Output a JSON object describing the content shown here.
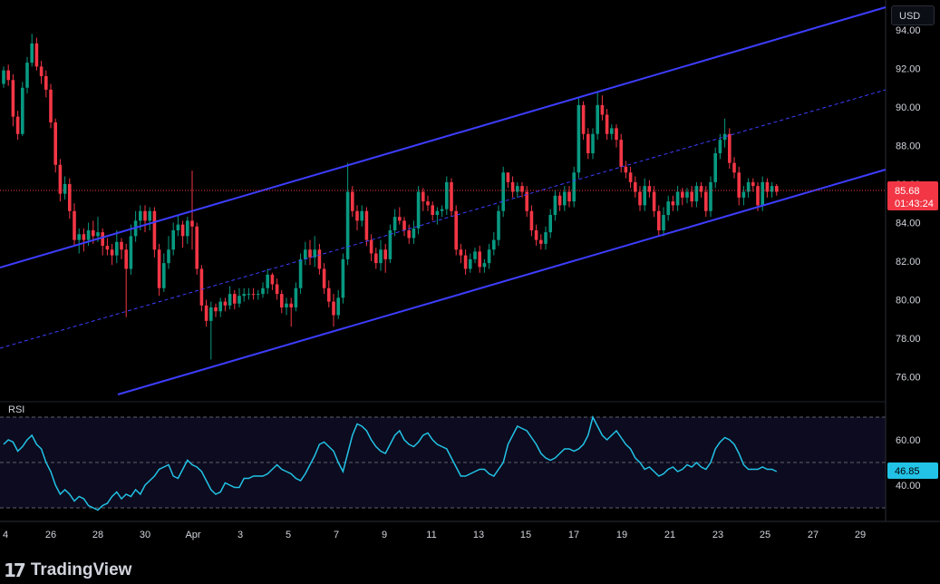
{
  "currency_label": "USD",
  "watermark": {
    "brand": "TradingView",
    "mark": "17"
  },
  "colors": {
    "up": "#089981",
    "down": "#f23645",
    "channel": "#3d3dff",
    "rsi": "#22c3e6",
    "price_line": "#f23645"
  },
  "price_badge": {
    "price": "85.68",
    "countdown": "01:43:24"
  },
  "rsi_badge": "46.85",
  "rsi_label": "RSI",
  "chart_data": {
    "type": "candlestick",
    "price_axis": {
      "ticks": [
        "94.00",
        "92.00",
        "90.00",
        "88.00",
        "86.00",
        "84.00",
        "82.00",
        "80.00",
        "78.00",
        "76.00"
      ],
      "range": [
        74.9,
        95.4
      ]
    },
    "rsi_axis": {
      "ticks": [
        "60.00",
        "40.00"
      ],
      "range": [
        25,
        80
      ],
      "bands": [
        70,
        50,
        30
      ]
    },
    "x_ticks": [
      "4",
      "26",
      "28",
      "30",
      "Apr",
      "3",
      "5",
      "7",
      "9",
      "11",
      "13",
      "15",
      "17",
      "19",
      "21",
      "23",
      "25",
      "27",
      "29"
    ],
    "candles": [
      [
        91.2,
        91.9,
        91.0,
        92.1,
        "up"
      ],
      [
        91.9,
        91.4,
        91.1,
        92.2,
        "dn"
      ],
      [
        91.4,
        89.5,
        89.0,
        91.7,
        "dn"
      ],
      [
        89.5,
        88.6,
        88.3,
        89.8,
        "dn"
      ],
      [
        88.6,
        91.0,
        88.5,
        91.3,
        "up"
      ],
      [
        91.0,
        92.3,
        90.7,
        92.6,
        "up"
      ],
      [
        92.3,
        93.3,
        92.1,
        93.8,
        "up"
      ],
      [
        93.3,
        92.1,
        91.9,
        93.6,
        "dn"
      ],
      [
        92.1,
        91.6,
        91.2,
        92.4,
        "dn"
      ],
      [
        91.6,
        90.9,
        90.5,
        91.9,
        "dn"
      ],
      [
        90.9,
        89.2,
        88.9,
        91.2,
        "dn"
      ],
      [
        89.2,
        87.0,
        86.6,
        89.4,
        "dn"
      ],
      [
        87.0,
        85.5,
        85.1,
        87.3,
        "dn"
      ],
      [
        85.5,
        86.0,
        85.2,
        86.4,
        "up"
      ],
      [
        86.0,
        84.6,
        84.2,
        86.3,
        "dn"
      ],
      [
        84.6,
        83.1,
        82.8,
        85.0,
        "dn"
      ],
      [
        83.1,
        83.4,
        82.4,
        83.7,
        "up"
      ],
      [
        83.4,
        83.1,
        82.5,
        83.7,
        "dn"
      ],
      [
        83.1,
        83.6,
        82.8,
        84.0,
        "up"
      ],
      [
        83.6,
        83.3,
        82.9,
        84.1,
        "dn"
      ],
      [
        83.3,
        83.5,
        83.0,
        84.3,
        "up"
      ],
      [
        83.5,
        82.8,
        82.3,
        83.7,
        "dn"
      ],
      [
        82.8,
        82.6,
        82.3,
        83.2,
        "dn"
      ],
      [
        82.6,
        82.3,
        81.8,
        82.9,
        "dn"
      ],
      [
        82.3,
        83.0,
        81.9,
        83.6,
        "up"
      ],
      [
        83.0,
        82.6,
        82.1,
        83.2,
        "dn"
      ],
      [
        82.6,
        81.6,
        79.1,
        82.9,
        "dn"
      ],
      [
        81.6,
        83.3,
        81.3,
        83.9,
        "up"
      ],
      [
        83.3,
        84.1,
        83.0,
        84.6,
        "up"
      ],
      [
        84.1,
        84.6,
        83.6,
        84.9,
        "up"
      ],
      [
        84.6,
        84.1,
        83.5,
        84.9,
        "dn"
      ],
      [
        84.1,
        84.6,
        83.6,
        84.8,
        "up"
      ],
      [
        84.6,
        82.6,
        82.2,
        84.8,
        "dn"
      ],
      [
        82.6,
        80.6,
        80.2,
        82.9,
        "dn"
      ],
      [
        80.6,
        81.9,
        80.4,
        82.4,
        "up"
      ],
      [
        81.9,
        82.6,
        81.6,
        83.3,
        "up"
      ],
      [
        82.6,
        83.6,
        82.3,
        84.0,
        "up"
      ],
      [
        83.6,
        83.9,
        83.3,
        84.4,
        "up"
      ],
      [
        83.9,
        83.3,
        82.7,
        84.1,
        "dn"
      ],
      [
        83.3,
        84.1,
        82.9,
        84.3,
        "up"
      ],
      [
        84.1,
        83.8,
        82.6,
        86.7,
        "dn"
      ],
      [
        83.8,
        81.6,
        81.3,
        84.0,
        "dn"
      ],
      [
        81.6,
        79.7,
        79.4,
        81.8,
        "dn"
      ],
      [
        79.7,
        78.9,
        78.6,
        80.0,
        "dn"
      ],
      [
        78.9,
        79.6,
        76.9,
        79.9,
        "up"
      ],
      [
        79.6,
        79.4,
        79.1,
        79.8,
        "dn"
      ],
      [
        79.4,
        79.9,
        79.1,
        80.1,
        "up"
      ],
      [
        79.9,
        79.7,
        79.4,
        80.1,
        "dn"
      ],
      [
        79.7,
        80.3,
        79.5,
        80.7,
        "up"
      ],
      [
        80.3,
        79.8,
        79.5,
        80.5,
        "dn"
      ],
      [
        79.8,
        80.2,
        79.6,
        80.6,
        "up"
      ],
      [
        80.2,
        80.3,
        79.9,
        80.6,
        "up"
      ],
      [
        80.3,
        80.3,
        80.0,
        80.6,
        "up"
      ],
      [
        80.3,
        80.3,
        80.0,
        80.6,
        "dn"
      ],
      [
        80.3,
        80.3,
        80.0,
        80.5,
        "up"
      ],
      [
        80.3,
        80.6,
        80.1,
        80.9,
        "up"
      ],
      [
        80.6,
        81.3,
        80.3,
        81.6,
        "up"
      ],
      [
        81.3,
        80.8,
        80.5,
        81.4,
        "dn"
      ],
      [
        80.8,
        80.3,
        80.0,
        81.1,
        "dn"
      ],
      [
        80.3,
        79.6,
        79.3,
        80.5,
        "dn"
      ],
      [
        79.6,
        79.8,
        79.2,
        80.1,
        "up"
      ],
      [
        79.8,
        79.6,
        78.6,
        80.1,
        "dn"
      ],
      [
        79.6,
        80.6,
        79.4,
        80.9,
        "up"
      ],
      [
        80.6,
        82.1,
        80.3,
        82.4,
        "up"
      ],
      [
        82.1,
        82.6,
        81.8,
        83.0,
        "up"
      ],
      [
        82.6,
        82.2,
        81.8,
        83.1,
        "dn"
      ],
      [
        82.2,
        82.6,
        81.7,
        83.3,
        "up"
      ],
      [
        82.6,
        81.6,
        81.3,
        82.9,
        "dn"
      ],
      [
        81.6,
        80.6,
        80.3,
        81.9,
        "dn"
      ],
      [
        80.6,
        79.9,
        79.6,
        81.0,
        "dn"
      ],
      [
        79.9,
        79.2,
        78.6,
        80.3,
        "dn"
      ],
      [
        79.2,
        80.1,
        79.0,
        80.5,
        "up"
      ],
      [
        80.1,
        82.1,
        79.8,
        82.4,
        "up"
      ],
      [
        82.1,
        85.6,
        81.8,
        87.1,
        "up"
      ],
      [
        85.6,
        84.6,
        84.3,
        85.9,
        "dn"
      ],
      [
        84.6,
        84.1,
        83.6,
        84.9,
        "dn"
      ],
      [
        84.1,
        84.6,
        83.8,
        84.9,
        "up"
      ],
      [
        84.6,
        83.1,
        82.8,
        84.8,
        "dn"
      ],
      [
        83.1,
        82.4,
        82.0,
        83.4,
        "dn"
      ],
      [
        82.4,
        81.9,
        81.6,
        82.7,
        "dn"
      ],
      [
        81.9,
        82.6,
        81.5,
        83.1,
        "up"
      ],
      [
        82.6,
        82.1,
        81.4,
        82.9,
        "dn"
      ],
      [
        82.1,
        83.6,
        81.9,
        83.9,
        "up"
      ],
      [
        83.6,
        84.3,
        83.3,
        84.7,
        "up"
      ],
      [
        84.3,
        84.1,
        83.9,
        84.8,
        "dn"
      ],
      [
        84.1,
        83.6,
        83.3,
        84.3,
        "dn"
      ],
      [
        83.6,
        83.2,
        82.9,
        83.9,
        "dn"
      ],
      [
        83.2,
        83.7,
        82.9,
        84.1,
        "up"
      ],
      [
        83.7,
        85.6,
        83.4,
        85.9,
        "up"
      ],
      [
        85.6,
        85.1,
        84.6,
        85.8,
        "dn"
      ],
      [
        85.1,
        84.9,
        84.6,
        85.4,
        "dn"
      ],
      [
        84.9,
        84.4,
        84.1,
        85.1,
        "dn"
      ],
      [
        84.4,
        84.6,
        83.9,
        84.8,
        "up"
      ],
      [
        84.6,
        84.7,
        84.3,
        84.9,
        "up"
      ],
      [
        84.7,
        86.1,
        84.4,
        86.4,
        "up"
      ],
      [
        86.1,
        84.6,
        84.3,
        86.3,
        "dn"
      ],
      [
        84.6,
        82.6,
        82.3,
        84.9,
        "dn"
      ],
      [
        82.6,
        82.3,
        81.9,
        82.9,
        "dn"
      ],
      [
        82.3,
        81.6,
        81.3,
        82.6,
        "dn"
      ],
      [
        81.6,
        82.1,
        81.4,
        82.4,
        "up"
      ],
      [
        82.1,
        82.5,
        81.9,
        82.7,
        "up"
      ],
      [
        82.5,
        81.7,
        81.4,
        82.8,
        "dn"
      ],
      [
        81.7,
        81.9,
        81.4,
        82.1,
        "up"
      ],
      [
        81.9,
        82.6,
        81.6,
        82.9,
        "up"
      ],
      [
        82.6,
        83.1,
        82.3,
        83.5,
        "up"
      ],
      [
        83.1,
        84.6,
        82.8,
        84.9,
        "up"
      ],
      [
        84.6,
        86.6,
        84.3,
        86.9,
        "up"
      ],
      [
        86.6,
        86.1,
        85.8,
        86.6,
        "dn"
      ],
      [
        86.1,
        85.6,
        85.3,
        86.4,
        "dn"
      ],
      [
        85.6,
        85.9,
        85.3,
        86.1,
        "up"
      ],
      [
        85.9,
        85.6,
        85.3,
        86.1,
        "dn"
      ],
      [
        85.6,
        84.6,
        84.3,
        85.9,
        "dn"
      ],
      [
        84.6,
        83.6,
        83.3,
        84.9,
        "dn"
      ],
      [
        83.6,
        83.1,
        82.8,
        83.9,
        "dn"
      ],
      [
        83.1,
        82.9,
        82.6,
        83.4,
        "dn"
      ],
      [
        82.9,
        83.5,
        82.6,
        83.8,
        "up"
      ],
      [
        83.5,
        84.4,
        83.2,
        84.7,
        "up"
      ],
      [
        84.4,
        85.4,
        84.1,
        85.7,
        "up"
      ],
      [
        85.4,
        84.9,
        84.6,
        85.6,
        "dn"
      ],
      [
        84.9,
        85.6,
        84.6,
        85.9,
        "up"
      ],
      [
        85.6,
        85.1,
        84.8,
        85.9,
        "dn"
      ],
      [
        85.1,
        86.6,
        84.8,
        86.9,
        "up"
      ],
      [
        86.6,
        90.1,
        86.3,
        90.5,
        "up"
      ],
      [
        90.1,
        88.6,
        88.3,
        90.3,
        "dn"
      ],
      [
        88.6,
        87.6,
        87.3,
        88.9,
        "dn"
      ],
      [
        87.6,
        88.6,
        87.3,
        88.9,
        "up"
      ],
      [
        88.6,
        90.1,
        88.3,
        90.8,
        "up"
      ],
      [
        90.1,
        89.6,
        89.3,
        90.6,
        "dn"
      ],
      [
        89.6,
        88.6,
        88.3,
        89.9,
        "dn"
      ],
      [
        88.6,
        88.9,
        88.3,
        89.1,
        "up"
      ],
      [
        88.9,
        88.3,
        87.9,
        89.1,
        "dn"
      ],
      [
        88.3,
        86.9,
        86.6,
        88.6,
        "dn"
      ],
      [
        86.9,
        86.6,
        86.3,
        87.2,
        "dn"
      ],
      [
        86.6,
        86.1,
        85.8,
        86.9,
        "dn"
      ],
      [
        86.1,
        85.6,
        85.3,
        86.4,
        "dn"
      ],
      [
        85.6,
        84.9,
        84.6,
        85.9,
        "dn"
      ],
      [
        84.9,
        85.9,
        84.6,
        86.3,
        "up"
      ],
      [
        85.9,
        85.6,
        85.3,
        86.2,
        "dn"
      ],
      [
        85.6,
        84.6,
        84.3,
        85.9,
        "dn"
      ],
      [
        84.6,
        83.6,
        83.3,
        84.9,
        "dn"
      ],
      [
        83.6,
        84.4,
        83.3,
        84.8,
        "up"
      ],
      [
        84.4,
        85.1,
        84.1,
        85.4,
        "up"
      ],
      [
        85.1,
        84.9,
        84.6,
        85.4,
        "dn"
      ],
      [
        84.9,
        85.6,
        84.6,
        85.9,
        "up"
      ],
      [
        85.6,
        85.3,
        84.9,
        85.8,
        "dn"
      ],
      [
        85.3,
        85.6,
        85.0,
        85.8,
        "up"
      ],
      [
        85.6,
        85.1,
        84.8,
        85.9,
        "dn"
      ],
      [
        85.1,
        85.9,
        84.8,
        86.1,
        "up"
      ],
      [
        85.9,
        85.6,
        85.3,
        86.1,
        "dn"
      ],
      [
        85.6,
        84.6,
        84.3,
        85.9,
        "dn"
      ],
      [
        84.6,
        86.1,
        84.3,
        86.4,
        "up"
      ],
      [
        86.1,
        87.6,
        85.8,
        87.9,
        "up"
      ],
      [
        87.6,
        88.3,
        87.3,
        88.6,
        "up"
      ],
      [
        88.3,
        88.6,
        87.9,
        89.4,
        "up"
      ],
      [
        88.6,
        87.1,
        86.8,
        88.9,
        "dn"
      ],
      [
        87.1,
        86.6,
        86.3,
        87.4,
        "dn"
      ],
      [
        86.6,
        85.3,
        84.9,
        86.9,
        "dn"
      ],
      [
        85.3,
        85.6,
        84.9,
        85.9,
        "up"
      ],
      [
        85.6,
        86.1,
        85.3,
        86.3,
        "up"
      ],
      [
        86.1,
        85.9,
        85.6,
        86.3,
        "dn"
      ],
      [
        85.9,
        84.9,
        84.6,
        86.1,
        "dn"
      ],
      [
        84.9,
        86.1,
        84.6,
        86.4,
        "up"
      ],
      [
        86.1,
        85.6,
        85.3,
        86.3,
        "dn"
      ],
      [
        85.6,
        85.9,
        85.3,
        86.1,
        "up"
      ],
      [
        85.9,
        85.6,
        85.4,
        86.0,
        "dn"
      ]
    ],
    "rsi": [
      58,
      60,
      59,
      55,
      57,
      60,
      62,
      58,
      56,
      50,
      46,
      40,
      36,
      38,
      36,
      33,
      35,
      34,
      31,
      30,
      29,
      31,
      32,
      35,
      37,
      34,
      36,
      35,
      38,
      36,
      40,
      42,
      44,
      47,
      48,
      49,
      44,
      43,
      47,
      51,
      49,
      48,
      46,
      42,
      38,
      36,
      37,
      41,
      40,
      39,
      39,
      43,
      43,
      44,
      44,
      44,
      45,
      47,
      49,
      47,
      46,
      45,
      43,
      42,
      45,
      49,
      53,
      58,
      59,
      57,
      55,
      50,
      46,
      54,
      62,
      67,
      66,
      64,
      60,
      57,
      55,
      54,
      58,
      62,
      64,
      60,
      58,
      57,
      59,
      62,
      63,
      60,
      58,
      57,
      56,
      52,
      48,
      44,
      44,
      45,
      46,
      47,
      47,
      45,
      44,
      47,
      50,
      58,
      62,
      66,
      65,
      64,
      61,
      58,
      54,
      52,
      51,
      52,
      54,
      56,
      56,
      55,
      56,
      58,
      62,
      70,
      66,
      62,
      60,
      62,
      64,
      61,
      58,
      56,
      52,
      50,
      47,
      48,
      46,
      44,
      45,
      47,
      48,
      46,
      47,
      49,
      48,
      50,
      48,
      47,
      50,
      56,
      59,
      61,
      60,
      58,
      54,
      49,
      47,
      47,
      47,
      48,
      47,
      47,
      46
    ]
  }
}
